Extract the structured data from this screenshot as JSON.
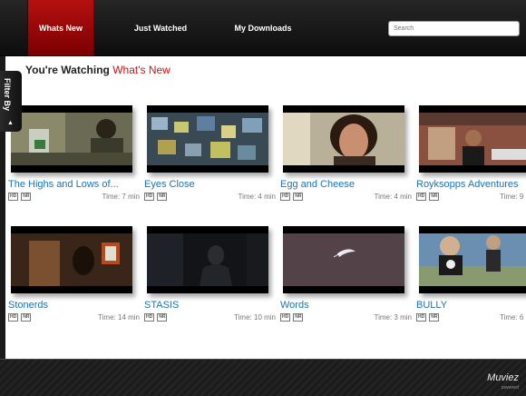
{
  "nav": {
    "tabs": [
      {
        "label": "Whats New",
        "active": true
      },
      {
        "label": "Just Watched",
        "active": false
      },
      {
        "label": "My Downloads",
        "active": false
      }
    ],
    "search_placeholder": "Search"
  },
  "heading": {
    "prefix": "You're Watching",
    "section": "What's New"
  },
  "filter": {
    "label": "Filter By",
    "icon": "up-arrow-icon"
  },
  "videos": [
    {
      "title": "The Highs and Lows of...",
      "hd": "HD",
      "rating": "NR",
      "time": "Time: 7 min"
    },
    {
      "title": "Eyes Close",
      "hd": "HD",
      "rating": "NR",
      "time": "Time: 4 min"
    },
    {
      "title": "Egg and Cheese",
      "hd": "HD",
      "rating": "NR",
      "time": "Time: 4 min"
    },
    {
      "title": "Royksopps Adventures",
      "hd": "HD",
      "rating": "NR",
      "time": "Time: 9"
    },
    {
      "title": "Stonerds",
      "hd": "HD",
      "rating": "NR",
      "time": "Time: 14 min"
    },
    {
      "title": "STASIS",
      "hd": "HD",
      "rating": "NR",
      "time": "Time: 10 min"
    },
    {
      "title": "Words",
      "hd": "HD",
      "rating": "NR",
      "time": "Time: 3 min"
    },
    {
      "title": "BULLY",
      "hd": "HD",
      "rating": "NR",
      "time": "Time: 6"
    }
  ],
  "brand": {
    "logo": "Muviez",
    "powered": "powered"
  },
  "colors": {
    "accent": "#c81616",
    "link": "#1a74b8"
  }
}
